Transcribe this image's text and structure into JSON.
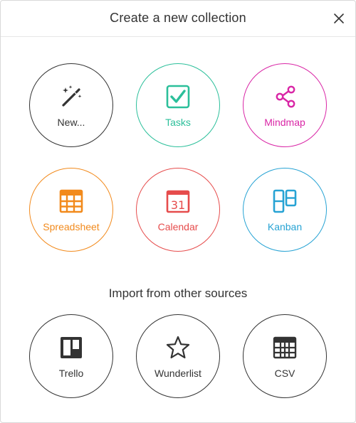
{
  "header": {
    "title": "Create a new collection"
  },
  "templates": [
    {
      "label": "New...",
      "icon": "magic-wand-icon",
      "color": "#333333"
    },
    {
      "label": "Tasks",
      "icon": "checkbox-icon",
      "color": "#2bbf9a"
    },
    {
      "label": "Mindmap",
      "icon": "mindmap-icon",
      "color": "#d926a6"
    },
    {
      "label": "Spreadsheet",
      "icon": "spreadsheet-icon",
      "color": "#f28a1c"
    },
    {
      "label": "Calendar",
      "icon": "calendar-icon",
      "color": "#e64c4c",
      "day": "31"
    },
    {
      "label": "Kanban",
      "icon": "kanban-icon",
      "color": "#27a3d4"
    }
  ],
  "import": {
    "title": "Import from other sources",
    "sources": [
      {
        "label": "Trello",
        "icon": "trello-icon",
        "color": "#333333"
      },
      {
        "label": "Wunderlist",
        "icon": "star-icon",
        "color": "#333333"
      },
      {
        "label": "CSV",
        "icon": "table-icon",
        "color": "#333333"
      }
    ]
  }
}
